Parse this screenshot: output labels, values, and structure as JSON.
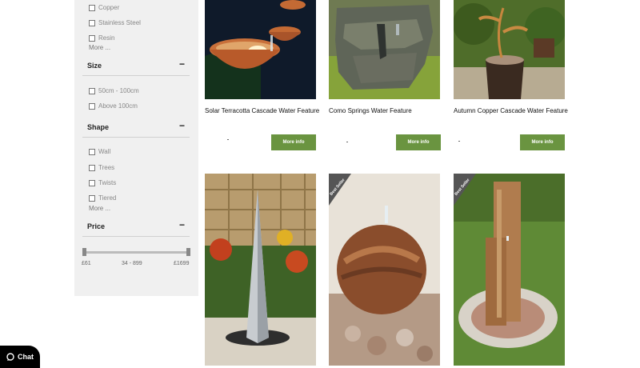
{
  "filters": {
    "material_options": [
      "Copper",
      "Stainless Steel",
      "Resin"
    ],
    "material_more": "More ...",
    "size": {
      "title": "Size",
      "toggle": "−",
      "options": [
        "50cm - 100cm",
        "Above 100cm"
      ]
    },
    "shape": {
      "title": "Shape",
      "toggle": "−",
      "options": [
        "Wall",
        "Trees",
        "Twists",
        "Tiered"
      ],
      "more": "More ..."
    },
    "price": {
      "title": "Price",
      "toggle": "−",
      "min_label": "£61",
      "range_label": "34 - 899",
      "max_label": "£1699",
      "min_fraction": 0.0,
      "max_fraction": 1.0
    }
  },
  "products": [
    {
      "title": "Solar Terracotta Cascade Water Feature",
      "button": "More info"
    },
    {
      "title": "Como Springs Water Feature",
      "button": "More info"
    },
    {
      "title": "Autumn Copper Cascade Water Feature",
      "button": "More info"
    }
  ],
  "badges": {
    "best_seller": "Best Seller"
  },
  "chat": {
    "label": "Chat"
  }
}
